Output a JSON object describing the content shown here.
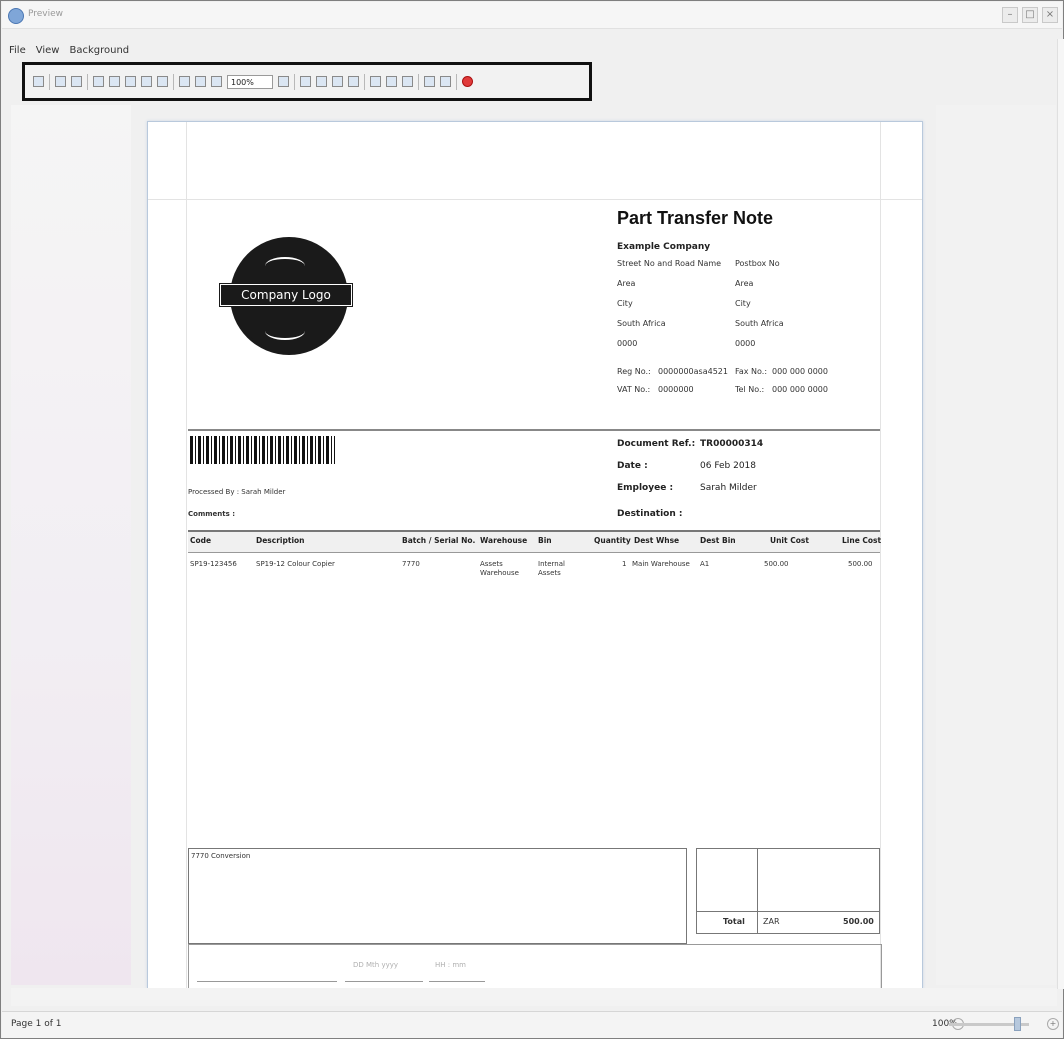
{
  "window": {
    "title": "Preview",
    "controls": [
      "–",
      "□",
      "×"
    ]
  },
  "menu": [
    "File",
    "View",
    "Background"
  ],
  "toolbar": {
    "zoom_value": "100%"
  },
  "document": {
    "title": "Part Transfer Note",
    "company": "Example Company",
    "address_left": [
      "Street No and Road Name",
      "Area",
      "City",
      "South Africa",
      "0000"
    ],
    "address_right": [
      "Postbox No",
      "Area",
      "City",
      "South Africa",
      "0000"
    ],
    "reg_label": "Reg No.:",
    "reg_value": "0000000asa4521",
    "vat_label": "VAT No.:",
    "vat_value": "0000000",
    "fax_label": "Fax No.:",
    "fax_value": "000 000 0000",
    "tel_label": "Tel No.:",
    "tel_value": "000 000 0000",
    "logo_text": "Company Logo",
    "processed_by": "Processed By : Sarah Milder",
    "comments_label": "Comments :",
    "doc_ref_label": "Document Ref.:",
    "doc_ref_value": "TR00000314",
    "date_label": "Date :",
    "date_value": "06 Feb 2018",
    "employee_label": "Employee :",
    "employee_value": "Sarah Milder",
    "destination_label": "Destination :",
    "columns": [
      "Code",
      "Description",
      "Batch / Serial No.",
      "Warehouse",
      "Bin",
      "Quantity",
      "Dest Whse",
      "Dest Bin",
      "Unit Cost",
      "Line Cost"
    ],
    "row": {
      "code": "SP19-123456",
      "description": "SP19-12 Colour Copier",
      "batch": "7770",
      "warehouse": "Assets Warehouse",
      "bin": "Internal Assets",
      "quantity": "1",
      "dest_whse": "Main Warehouse",
      "dest_bin": "A1",
      "unit_cost": "500.00",
      "line_cost": "500.00"
    },
    "note": "7770 Conversion",
    "total_label": "Total",
    "total_currency": "ZAR",
    "total_value": "500.00",
    "footer_fields": [
      "DD Mth yyyy",
      "HH : mm"
    ]
  },
  "status": {
    "page": "Page 1 of 1",
    "zoom": "100%"
  }
}
